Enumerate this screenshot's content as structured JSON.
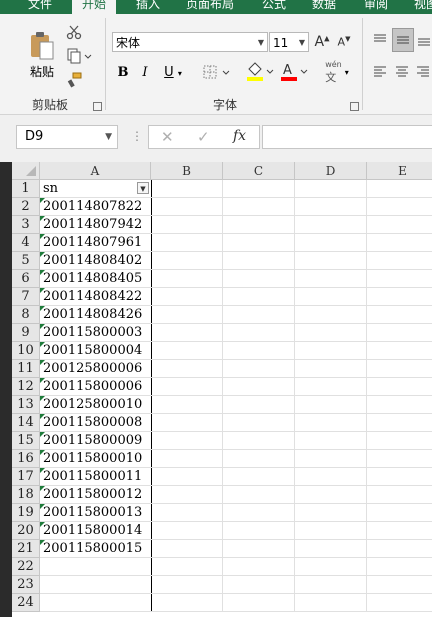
{
  "ribbon_tabs": [
    {
      "label": "文件"
    },
    {
      "label": "开始"
    },
    {
      "label": "插入"
    },
    {
      "label": "页面布局"
    },
    {
      "label": "公式"
    },
    {
      "label": "数据"
    },
    {
      "label": "审阅"
    },
    {
      "label": "视图"
    }
  ],
  "clipboard": {
    "paste_label": "粘贴",
    "group_label": "剪贴板"
  },
  "font": {
    "name": "宋体",
    "size": "11",
    "group_label": "字体",
    "phonetic_glyph": "wén",
    "highlight_color": "#ffff00",
    "font_color": "#ff0000"
  },
  "formula_bar": {
    "name_box": "D9",
    "fx_label": "fx",
    "value": ""
  },
  "columns": [
    "A",
    "B",
    "C",
    "D",
    "E"
  ],
  "rows": [
    {
      "num": "1",
      "a": "sn"
    },
    {
      "num": "2",
      "a": "200114807822"
    },
    {
      "num": "3",
      "a": "200114807942"
    },
    {
      "num": "4",
      "a": "200114807961"
    },
    {
      "num": "5",
      "a": "200114808402"
    },
    {
      "num": "6",
      "a": "200114808405"
    },
    {
      "num": "7",
      "a": "200114808422"
    },
    {
      "num": "8",
      "a": "200114808426"
    },
    {
      "num": "9",
      "a": "200115800003"
    },
    {
      "num": "10",
      "a": "200115800004"
    },
    {
      "num": "11",
      "a": "200125800006"
    },
    {
      "num": "12",
      "a": "200115800006"
    },
    {
      "num": "13",
      "a": "200125800010"
    },
    {
      "num": "14",
      "a": "200115800008"
    },
    {
      "num": "15",
      "a": "200115800009"
    },
    {
      "num": "16",
      "a": "200115800010"
    },
    {
      "num": "17",
      "a": "200115800011"
    },
    {
      "num": "18",
      "a": "200115800012"
    },
    {
      "num": "19",
      "a": "200115800013"
    },
    {
      "num": "20",
      "a": "200115800014"
    },
    {
      "num": "21",
      "a": "200115800015"
    },
    {
      "num": "22",
      "a": ""
    },
    {
      "num": "23",
      "a": ""
    },
    {
      "num": "24",
      "a": ""
    }
  ]
}
